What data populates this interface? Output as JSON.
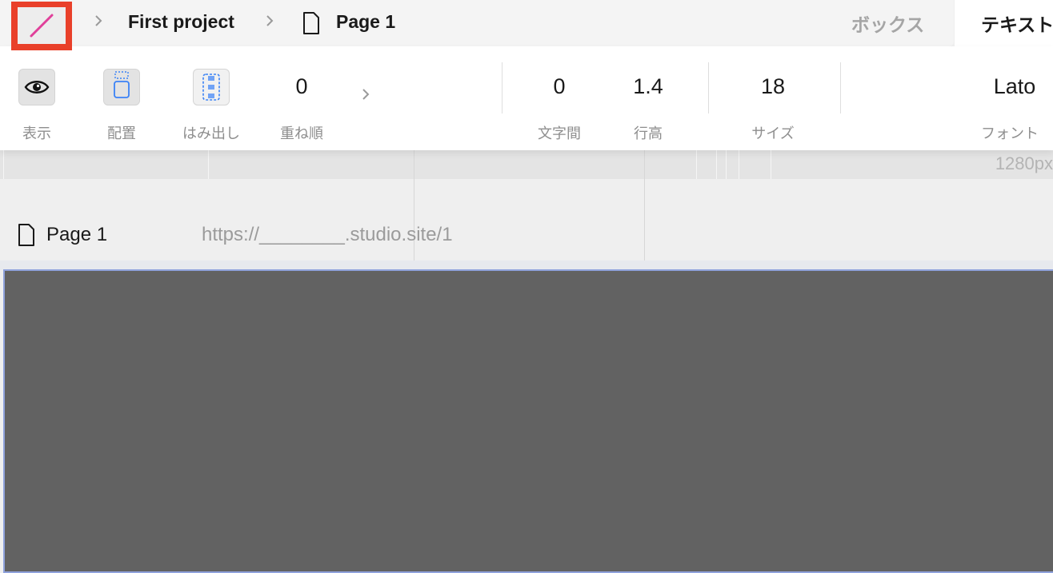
{
  "breadcrumb": {
    "project": "First project",
    "page": "Page 1"
  },
  "tabs": [
    {
      "label": "ボックス",
      "active": false
    },
    {
      "label": "テキスト",
      "active": true
    }
  ],
  "toolbar": {
    "visibility_label": "表示",
    "align_label": "配置",
    "overflow_label": "はみ出し",
    "zorder_value": "0",
    "zorder_label": "重ね順",
    "letter_spacing_value": "0",
    "letter_spacing_label": "文字間",
    "line_height_value": "1.4",
    "line_height_label": "行高",
    "size_value": "18",
    "size_label": "サイズ",
    "font_value": "Lato",
    "font_label": "フォント"
  },
  "ruler": {
    "width_label": "1280px"
  },
  "page_row": {
    "name": "Page 1",
    "url": "https://________.studio.site/1"
  },
  "colors": {
    "highlight": "#e9402a",
    "logo_stroke": "#e0409a",
    "canvas": "#626262",
    "selection": "#8fa2dc"
  },
  "icons": [
    "logo-icon",
    "chevron-right-icon",
    "page-icon",
    "eye-icon",
    "align-icon",
    "overflow-icon"
  ]
}
